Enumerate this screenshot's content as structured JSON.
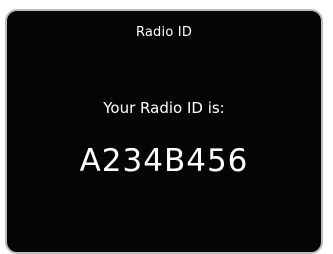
{
  "header": {
    "title": "Radio ID"
  },
  "content": {
    "label": "Your Radio ID is:",
    "radio_id": "A234B456"
  },
  "colors": {
    "background": "#050505",
    "text": "#ffffff",
    "border": "#bdbdbd"
  }
}
